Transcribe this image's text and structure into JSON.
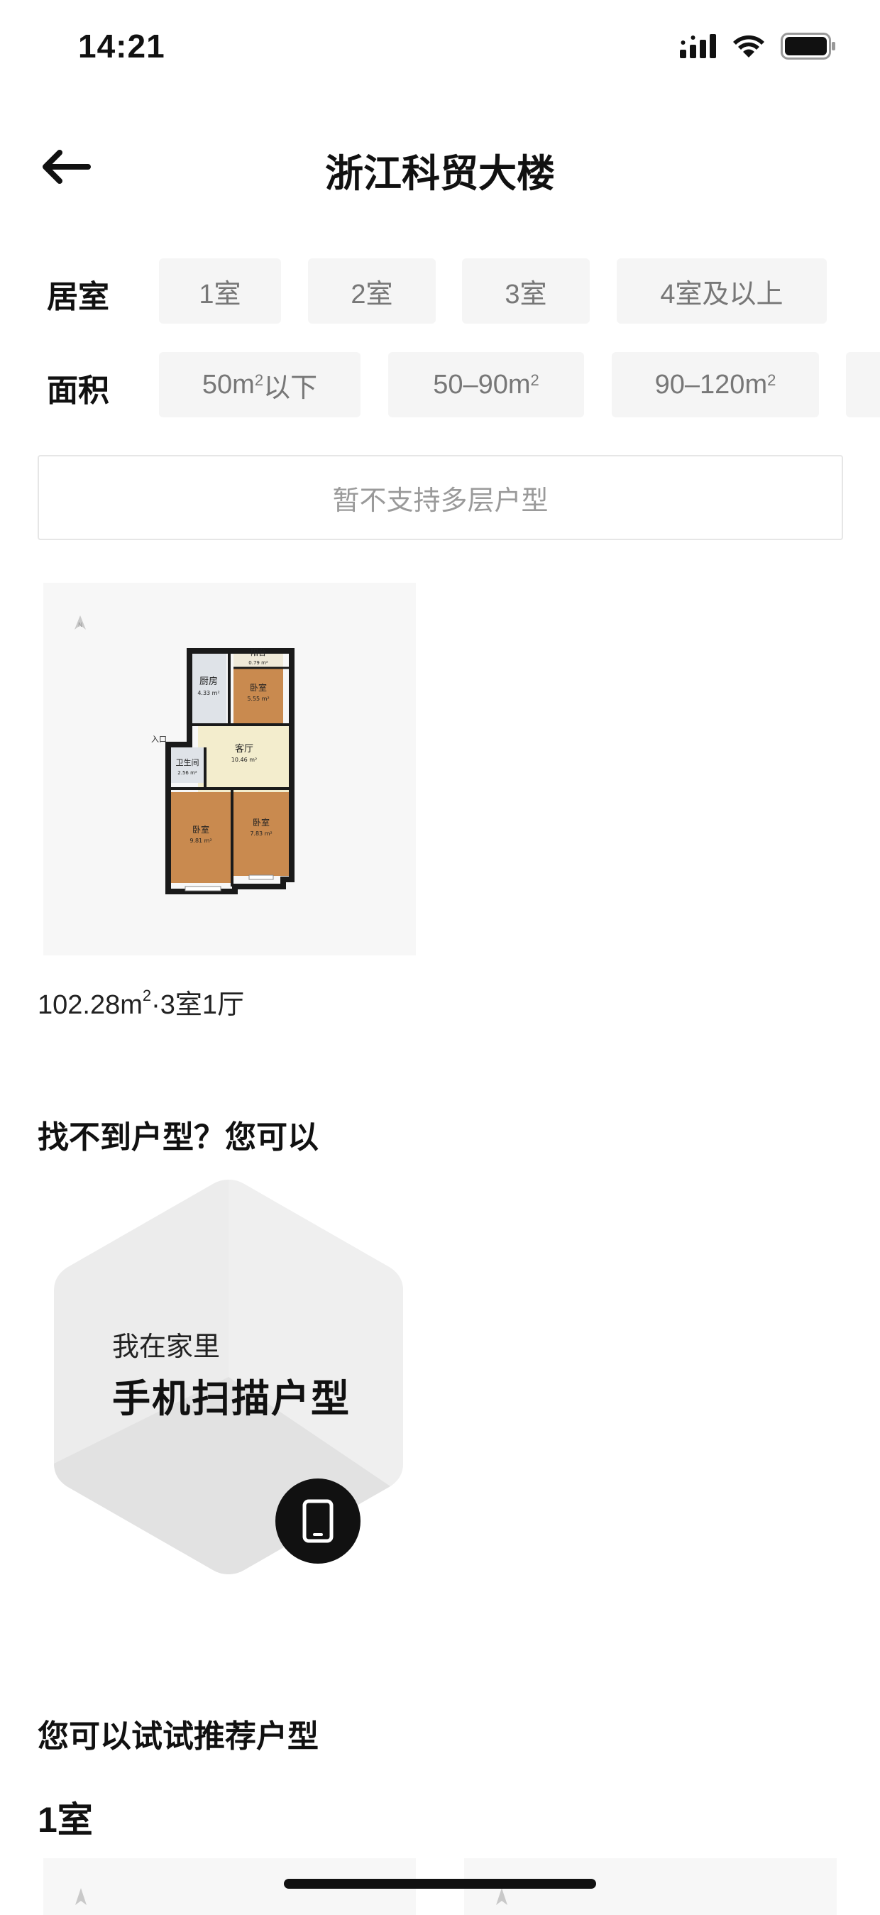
{
  "status_bar": {
    "time": "14:21",
    "icons": [
      "cellular-signal-icon",
      "wifi-icon",
      "battery-icon"
    ]
  },
  "header": {
    "back_icon": "back-arrow-icon",
    "title": "浙江科贸大楼"
  },
  "filters": {
    "room": {
      "label": "居室",
      "options": [
        "1室",
        "2室",
        "3室",
        "4室及以上"
      ]
    },
    "area": {
      "label": "面积",
      "options": [
        {
          "pre": "50m",
          "sup": "2",
          "post": "以下"
        },
        {
          "pre": "50–90m",
          "sup": "2",
          "post": ""
        },
        {
          "pre": "90–120m",
          "sup": "2",
          "post": ""
        }
      ]
    }
  },
  "notice": "暂不支持多层户型",
  "floor_plan": {
    "caption_pre": "102.28m",
    "caption_sup": "2",
    "caption_post": "·3室1厅",
    "rooms": [
      {
        "name": "厨房",
        "area": "4.33 m²"
      },
      {
        "name": "阳台",
        "area": "0.79 m²"
      },
      {
        "name": "卧室",
        "area": "5.55 m²"
      },
      {
        "name": "客厅",
        "area": "10.46 m²"
      },
      {
        "name": "卫生间",
        "area": "2.56 m²"
      },
      {
        "name": "卧室",
        "area": "9.81 m²"
      },
      {
        "name": "卧室",
        "area": "7.83 m²"
      }
    ],
    "entrance": "入口"
  },
  "not_found": {
    "title": "找不到户型？您可以",
    "scan_card": {
      "subtitle": "我在家里",
      "title": "手机扫描户型",
      "icon": "phone-icon"
    }
  },
  "recommend": {
    "title": "您可以试试推荐户型",
    "group_label": "1室"
  },
  "colors": {
    "chip_bg": "#f5f5f5",
    "chip_text": "#777777",
    "bedroom": "#c98a4f",
    "living": "#f3edcd",
    "wall": "#1a1a1a"
  }
}
